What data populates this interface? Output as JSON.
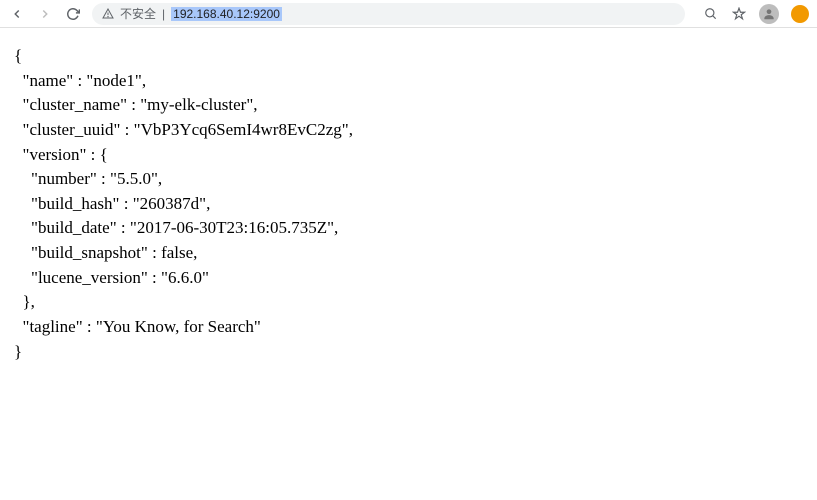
{
  "toolbar": {
    "not_secure_label": "不安全",
    "separator": " | ",
    "url": "192.168.40.12:9200"
  },
  "response": {
    "name": "node1",
    "cluster_name": "my-elk-cluster",
    "cluster_uuid": "VbP3Ycq6SemI4wr8EvC2zg",
    "version": {
      "number": "5.5.0",
      "build_hash": "260387d",
      "build_date": "2017-06-30T23:16:05.735Z",
      "build_snapshot": false,
      "lucene_version": "6.6.0"
    },
    "tagline": "You Know, for Search"
  }
}
